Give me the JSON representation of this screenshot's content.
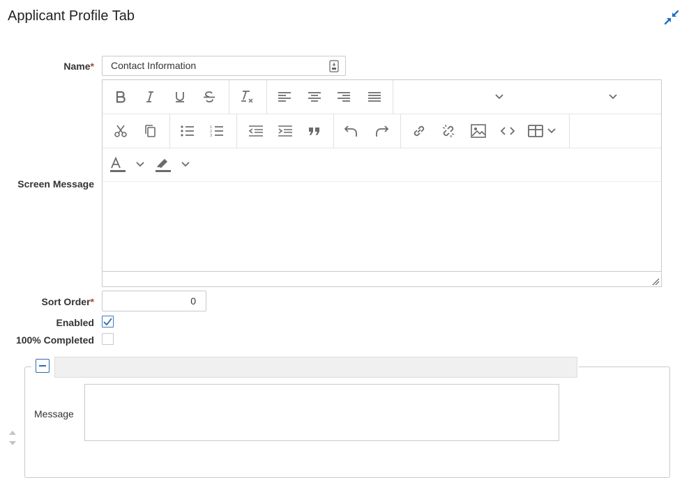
{
  "page": {
    "title": "Applicant Profile Tab"
  },
  "form": {
    "name_label": "Name",
    "required_mark": "*",
    "name_value": "Contact Information",
    "screen_message_label": "Screen Message",
    "sort_order_label": "Sort Order",
    "sort_order_value": "0",
    "enabled_label": "Enabled",
    "enabled_checked": true,
    "completed_label": "100% Completed",
    "completed_checked": false
  },
  "editor_toolbar": {
    "row1": [
      "bold-icon",
      "italic-icon",
      "underline-icon",
      "strikethrough-icon",
      "clear-format-icon",
      "align-left-icon",
      "align-center-icon",
      "align-right-icon",
      "align-justify-icon",
      "chevron-down-icon",
      "chevron-down-icon"
    ],
    "row2": [
      "cut-icon",
      "copy-icon",
      "bullet-list-icon",
      "numbered-list-icon",
      "outdent-icon",
      "indent-icon",
      "blockquote-icon",
      "undo-icon",
      "redo-icon",
      "link-icon",
      "unlink-icon",
      "image-icon",
      "code-icon",
      "table-icon"
    ],
    "row3": [
      "font-color-icon",
      "highlight-color-icon"
    ]
  },
  "subsection": {
    "message_label": "Message",
    "message_value": ""
  },
  "colors": {
    "accent": "#2d6aa8",
    "icon": "#6b6b6b",
    "required": "#a94442"
  }
}
